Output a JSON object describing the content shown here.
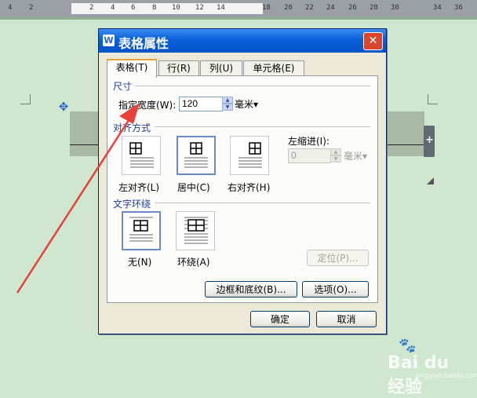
{
  "ruler": {
    "labels": [
      "4",
      "2",
      "",
      "2",
      "4",
      "6",
      "8",
      "10",
      "12",
      "14",
      "",
      "18",
      "20",
      "22",
      "24",
      "26",
      "28",
      "30",
      "",
      "34",
      "36"
    ]
  },
  "dialog": {
    "title": "表格属性",
    "app_icon": "W",
    "close_icon": "close-icon",
    "tabs": [
      {
        "label": "表格(T)",
        "active": true
      },
      {
        "label": "行(R)",
        "active": false
      },
      {
        "label": "列(U)",
        "active": false
      },
      {
        "label": "单元格(E)",
        "active": false
      }
    ],
    "size_section": {
      "label": "尺寸",
      "width_label": "指定宽度(W):",
      "width_value": "120",
      "width_unit": "毫米▾"
    },
    "align_section": {
      "label": "对齐方式",
      "options": [
        {
          "label": "左对齐(L)",
          "icon": "table-align-left-icon",
          "selected": false
        },
        {
          "label": "居中(C)",
          "icon": "table-align-center-icon",
          "selected": true
        },
        {
          "label": "右对齐(H)",
          "icon": "table-align-right-icon",
          "selected": false
        }
      ],
      "indent_label": "左缩进(I):",
      "indent_value": "0",
      "indent_unit": "毫米▾"
    },
    "wrap_section": {
      "label": "文字环绕",
      "options": [
        {
          "label": "无(N)",
          "icon": "wrap-none-icon",
          "selected": true
        },
        {
          "label": "环绕(A)",
          "icon": "wrap-around-icon",
          "selected": false
        }
      ],
      "position_button": "定位(P)..."
    },
    "border_button": "边框和底纹(B)...",
    "options_button": "选项(O)...",
    "ok_button": "确定",
    "cancel_button": "取消"
  },
  "document": {
    "move_icon": "move-icon",
    "add_column_icon": "plus-icon"
  },
  "watermark": {
    "text": "Bai du 经验",
    "sub": "jingyan.baidu.com"
  },
  "colors": {
    "background": "#cfe6cf",
    "titlebar": "#0a5fd8",
    "close": "#d9462c",
    "arrow": "#e8403a",
    "section_label": "#1f3c9a"
  }
}
